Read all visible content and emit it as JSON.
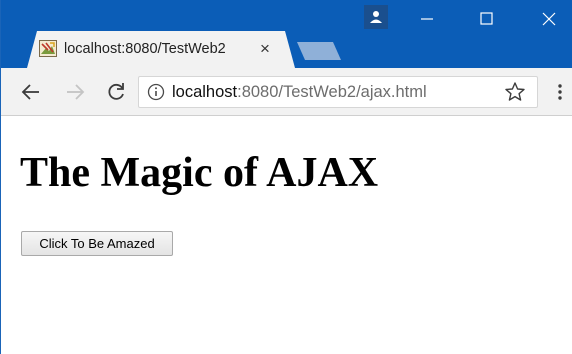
{
  "window": {
    "controls": {
      "minimize": "minimize-icon",
      "maximize": "maximize-icon",
      "close": "close-icon"
    },
    "accent_color": "#0b5db7"
  },
  "tab": {
    "title": "localhost:8080/TestWeb2",
    "close_icon": "close-icon",
    "favicon": "page-favicon-icon"
  },
  "toolbar": {
    "back_icon": "arrow-left-icon",
    "forward_icon": "arrow-right-icon",
    "reload_icon": "reload-icon",
    "site_info_icon": "info-icon",
    "bookmark_icon": "star-icon",
    "menu_icon": "more-vertical-icon"
  },
  "address_bar": {
    "host": "localhost",
    "path": ":8080/TestWeb2/ajax.html"
  },
  "page": {
    "heading": "The Magic of AJAX",
    "button_label": "Click To Be Amazed"
  }
}
